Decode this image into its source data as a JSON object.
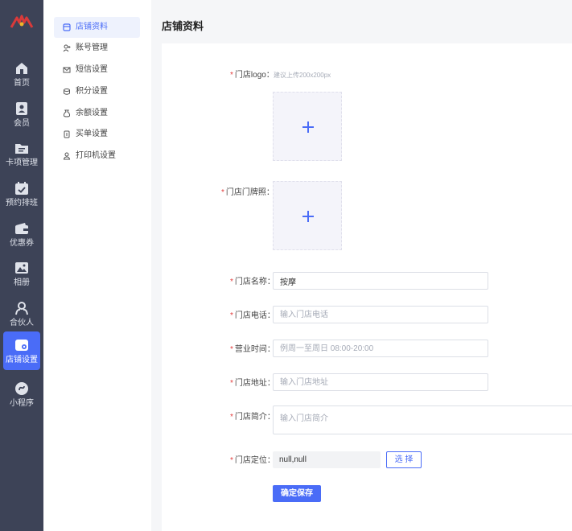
{
  "rail": {
    "items": [
      {
        "label": "首页",
        "icon": "home-icon"
      },
      {
        "label": "会员",
        "icon": "member-icon"
      },
      {
        "label": "卡项管理",
        "icon": "folder-icon"
      },
      {
        "label": "预约排班",
        "icon": "calendar-icon"
      },
      {
        "label": "优惠券",
        "icon": "wallet-icon"
      },
      {
        "label": "相册",
        "icon": "image-icon"
      },
      {
        "label": "合伙人",
        "icon": "partner-icon"
      },
      {
        "label": "店铺设置",
        "icon": "store-settings-icon",
        "active": true
      },
      {
        "label": "小程序",
        "icon": "mini-program-icon"
      }
    ]
  },
  "submenu": {
    "items": [
      {
        "label": "店铺资料",
        "icon": "store-icon",
        "active": true
      },
      {
        "label": "账号管理",
        "icon": "user-add-icon"
      },
      {
        "label": "短信设置",
        "icon": "mail-icon"
      },
      {
        "label": "积分设置",
        "icon": "coins-icon"
      },
      {
        "label": "余额设置",
        "icon": "money-bag-icon"
      },
      {
        "label": "买单设置",
        "icon": "receipt-icon"
      },
      {
        "label": "打印机设置",
        "icon": "printer-icon"
      }
    ]
  },
  "page": {
    "title": "店铺资料"
  },
  "form": {
    "logo": {
      "label": "门店logo：",
      "hint": "建议上传200x200px"
    },
    "sign_photo": {
      "label": "门店门牌照："
    },
    "name": {
      "label": "门店名称：",
      "value": "按摩",
      "placeholder": ""
    },
    "phone": {
      "label": "门店电话：",
      "value": "",
      "placeholder": "输入门店电话"
    },
    "hours": {
      "label": "营业时间：",
      "value": "",
      "placeholder": "例周一至周日 08:00-20:00"
    },
    "address": {
      "label": "门店地址：",
      "value": "",
      "placeholder": "输入门店地址"
    },
    "intro": {
      "label": "门店简介：",
      "value": "",
      "placeholder": "输入门店简介"
    },
    "location": {
      "label": "门店定位：",
      "value": "null,null",
      "choose_label": "选 择"
    },
    "save_label": "确定保存"
  },
  "colors": {
    "accent": "#4a6cf7",
    "rail_bg": "#3d4357",
    "required": "#e23c3c"
  }
}
